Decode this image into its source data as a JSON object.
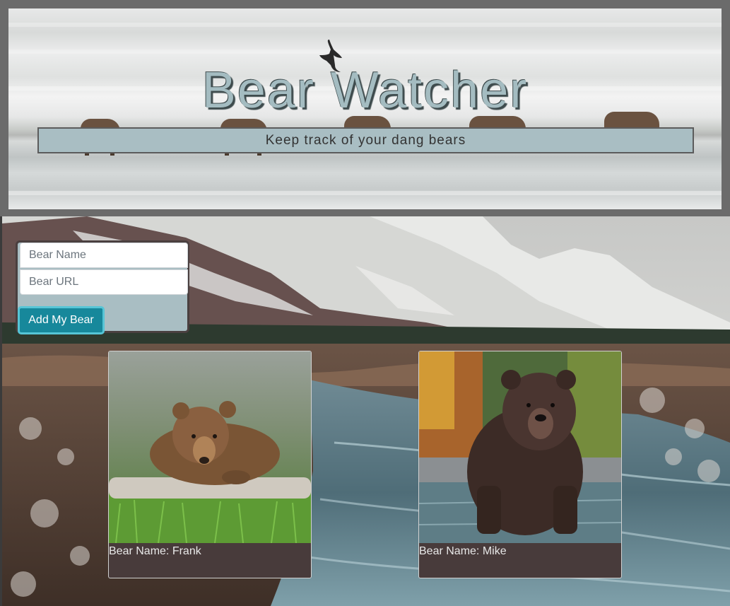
{
  "header": {
    "title": "Bear Watcher",
    "subtitle": "Keep track of your dang bears"
  },
  "form": {
    "name_placeholder": "Bear Name",
    "url_placeholder": "Bear URL",
    "submit_label": "Add My Bear"
  },
  "bears": [
    {
      "caption": "Bear Name: Frank"
    },
    {
      "caption": "Bear Name: Mike"
    }
  ],
  "colors": {
    "accent": "#a9bec3",
    "button": "#17889b",
    "card_footer": "#483b3b"
  }
}
